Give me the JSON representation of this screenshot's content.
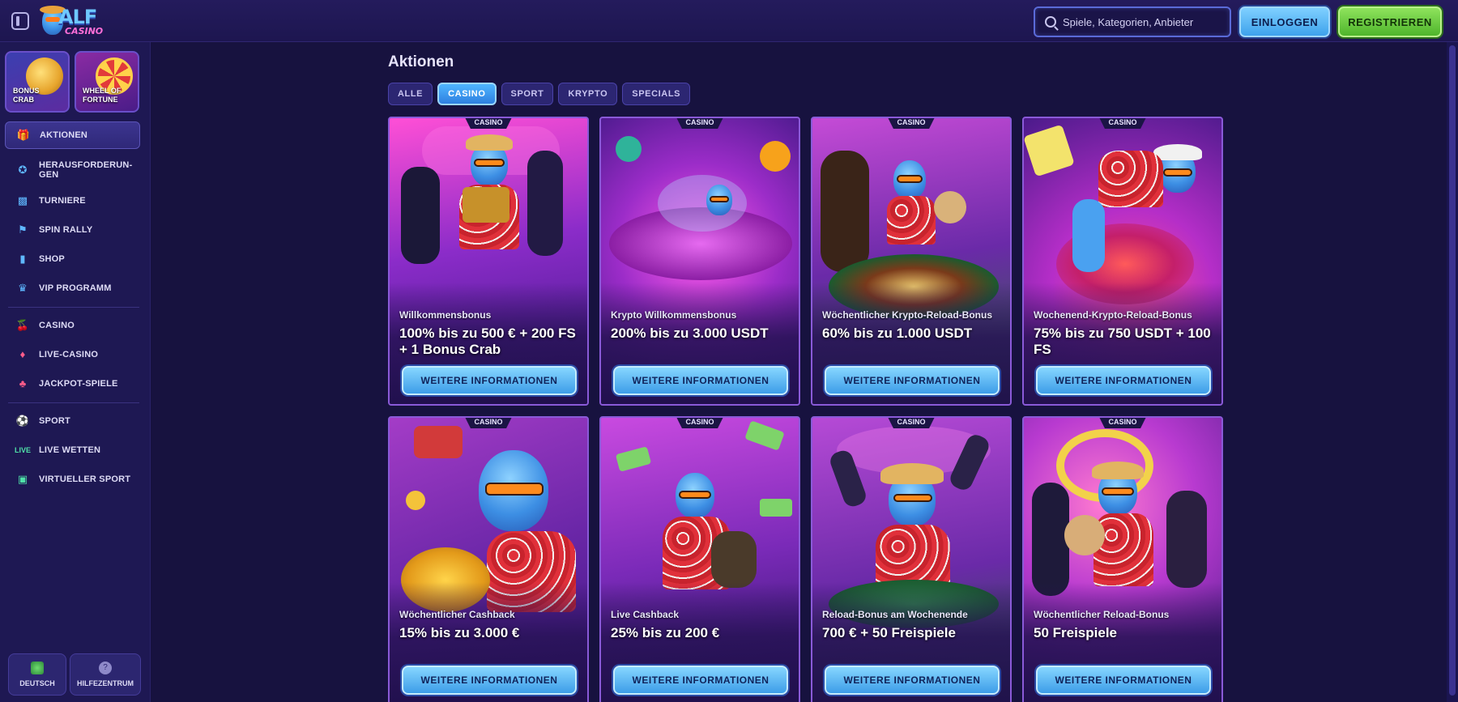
{
  "header": {
    "logo_text": "ALF",
    "logo_sub": "CASINO",
    "search_placeholder": "Spiele, Kategorien, Anbieter",
    "login_label": "EINLOGGEN",
    "register_label": "REGISTRIEREN"
  },
  "sidebar": {
    "promos": [
      {
        "label": "BONUS CRAB"
      },
      {
        "label": "WHEEL OF FORTUNE"
      }
    ],
    "items": [
      {
        "label": "AKTIONEN",
        "icon": "gift-icon",
        "active": true
      },
      {
        "label": "HERAUSFORDERUN-GEN",
        "icon": "medal-icon"
      },
      {
        "label": "TURNIERE",
        "icon": "podium-icon"
      },
      {
        "label": "SPIN RALLY",
        "icon": "flag-icon"
      },
      {
        "label": "SHOP",
        "icon": "bag-icon"
      },
      {
        "label": "VIP PROGRAMM",
        "icon": "crown-icon"
      },
      {
        "label": "CASINO",
        "icon": "cherry-icon"
      },
      {
        "label": "LIVE-CASINO",
        "icon": "live-cards-icon"
      },
      {
        "label": "JACKPOT-SPIELE",
        "icon": "clover-icon"
      },
      {
        "label": "SPORT",
        "icon": "ball-icon"
      },
      {
        "label": "LIVE WETTEN",
        "icon": "live-badge-icon"
      },
      {
        "label": "VIRTUELLER SPORT",
        "icon": "gamepad-icon"
      }
    ],
    "language_label": "DEUTSCH",
    "help_label": "HILFEZENTRUM"
  },
  "main": {
    "title": "Aktionen",
    "filters": [
      "ALLE",
      "CASINO",
      "SPORT",
      "KRYPTO",
      "SPECIALS"
    ],
    "active_filter": "CASINO",
    "cards": [
      {
        "badge": "CASINO",
        "subtitle": "Willkommensbonus",
        "title": "100% bis zu 500 € + 200 FS + 1 Bonus Crab",
        "button": "WEITERE INFORMATIONEN"
      },
      {
        "badge": "CASINO",
        "subtitle": "Krypto Willkommensbonus",
        "title": "200% bis zu 3.000 USDT",
        "button": "WEITERE INFORMATIONEN"
      },
      {
        "badge": "CASINO",
        "subtitle": "Wöchentlicher Krypto-Reload-Bonus",
        "title": "60% bis zu 1.000 USDT",
        "button": "WEITERE INFORMATIONEN"
      },
      {
        "badge": "CASINO",
        "subtitle": "Wochenend-Krypto-Reload-Bonus",
        "title": "75% bis zu 750 USDT + 100 FS",
        "button": "WEITERE INFORMATIONEN"
      },
      {
        "badge": "CASINO",
        "subtitle": "Wöchentlicher Cashback",
        "title": "15% bis zu 3.000 €",
        "button": "WEITERE INFORMATIONEN"
      },
      {
        "badge": "CASINO",
        "subtitle": "Live Cashback",
        "title": "25% bis zu 200 €",
        "button": "WEITERE INFORMATIONEN"
      },
      {
        "badge": "CASINO",
        "subtitle": "Reload-Bonus am Wochenende",
        "title": "700 € + 50 Freispiele",
        "button": "WEITERE INFORMATIONEN"
      },
      {
        "badge": "CASINO",
        "subtitle": "Wöchentlicher Reload-Bonus",
        "title": "50 Freispiele",
        "button": "WEITERE INFORMATIONEN"
      }
    ]
  },
  "colors": {
    "background": "#17123f",
    "accent_blue": "#4fb6ff",
    "accent_green": "#8ee35c",
    "card_border": "#8a5ad8"
  }
}
